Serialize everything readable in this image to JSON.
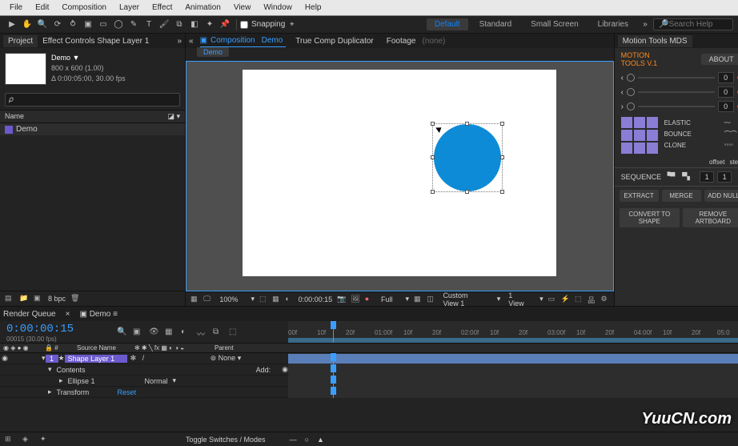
{
  "menu": [
    "File",
    "Edit",
    "Composition",
    "Layer",
    "Effect",
    "Animation",
    "View",
    "Window",
    "Help"
  ],
  "toolbar": {
    "snapping_label": "Snapping",
    "workspaces": [
      "Default",
      "Standard",
      "Small Screen",
      "Libraries"
    ],
    "search_placeholder": "Search Help"
  },
  "project_panel": {
    "tabs": [
      "Project",
      "Effect Controls Shape Layer 1"
    ],
    "comp_name": "Demo ▼",
    "dimensions": "800 x 600 (1.00)",
    "duration": "Δ 0:00:05:00, 30.00 fps",
    "search_placeholder": " ",
    "col_name": "Name",
    "item_name": "Demo",
    "footer_bpc": "8 bpc"
  },
  "viewer": {
    "tab_comp_prefix": "Composition",
    "tab_comp_name": "Demo",
    "tab_tcd": "True Comp Duplicator",
    "tab_footage": "Footage",
    "footage_none": "(none)",
    "flow_chip": "Demo",
    "zoom": "100%",
    "timecode": "0:00:00:15",
    "resolution": "Full",
    "view_mode": "Custom View 1",
    "views": "1 View"
  },
  "motion_tools": {
    "tab": "Motion Tools MDS",
    "logo_l1": "MOTION",
    "logo_l2": "TOOLS V.1",
    "about": "ABOUT",
    "rows": [
      {
        "value": "0"
      },
      {
        "value": "0"
      },
      {
        "value": "0"
      }
    ],
    "ease": [
      {
        "name": "ELASTIC"
      },
      {
        "name": "BOUNCE"
      },
      {
        "name": "CLONE"
      }
    ],
    "offset": "offset",
    "step": "step",
    "sequence": "SEQUENCE",
    "seq_val1": "1",
    "seq_val2": "1",
    "extract": "EXTRACT",
    "merge": "MERGE",
    "addnull": "ADD NULL",
    "convert": "CONVERT TO SHAPE",
    "remove_artboard": "REMOVE ARTBOARD"
  },
  "timeline": {
    "tab_render": "Render Queue",
    "tab_comp": "Demo",
    "timecode": "0:00:00:15",
    "tc_sub": "00015 (30.00 fps)",
    "cols": {
      "num": "#",
      "source": "Source Name",
      "parent": "Parent"
    },
    "layer": {
      "index": "1",
      "name": "Shape Layer 1",
      "mode": "None",
      "contents": "Contents",
      "add": "Add:",
      "ellipse": "Ellipse 1",
      "ellipse_mode": "Normal",
      "transform": "Transform",
      "reset": "Reset"
    },
    "ticks": [
      "00f",
      "10f",
      "20f",
      "01:00f",
      "10f",
      "20f",
      "02:00f",
      "10f",
      "20f",
      "03:00f",
      "10f",
      "20f",
      "04:00f",
      "10f",
      "20f",
      "05:0"
    ],
    "toggle": "Toggle Switches / Modes"
  },
  "watermark": "YuuCN.com"
}
